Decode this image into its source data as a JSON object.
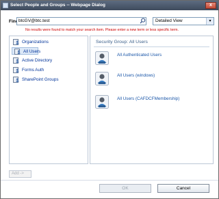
{
  "window": {
    "title": "Select People and Groups -- Webpage Dialog",
    "close_label": "x"
  },
  "search": {
    "find_label": "Find",
    "query": "btcGV@btc.test",
    "view_value": "Detailed View",
    "error_message": "No results were found to match your search item. Please enter a new term or less specific term."
  },
  "sidebar": {
    "items": [
      {
        "label": "Organizations"
      },
      {
        "label": "All Users"
      },
      {
        "label": "Active Directory"
      },
      {
        "label": "Forms Auth"
      },
      {
        "label": "SharePoint Groups"
      }
    ]
  },
  "results": {
    "header": "Security Group: All Users",
    "items": [
      {
        "label": "All Authenticated Users"
      },
      {
        "label": "All Users (windows)"
      },
      {
        "label": "All Users (CAFDCFMembership)"
      }
    ]
  },
  "footer": {
    "add_label": "Add ->",
    "ok_label": "OK",
    "cancel_label": "Cancel"
  },
  "colors": {
    "title_bar": "#3f4b5d",
    "error": "#cc0000",
    "link": "#1a56a8",
    "selection": "#dce8f7"
  }
}
